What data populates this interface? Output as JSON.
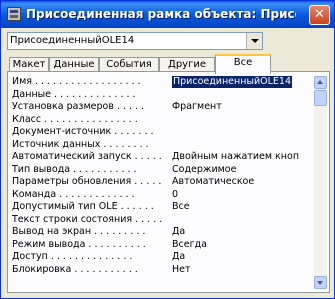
{
  "window": {
    "title": "Присоединенная рамка объекта: Присоедина...",
    "close_label": "✕"
  },
  "object_selector": {
    "value": "ПрисоединенныйOLE14"
  },
  "tabs": [
    {
      "label": "Макет"
    },
    {
      "label": "Данные"
    },
    {
      "label": "События"
    },
    {
      "label": "Другие"
    },
    {
      "label": "Все",
      "active": true
    }
  ],
  "properties": [
    {
      "name": "Имя . . . . . . . . . . . . . . . . . .",
      "value": "ПрисоединенныйOLE14"
    },
    {
      "name": "Данные . . . . . . . . . . . . . .",
      "value": ""
    },
    {
      "name": "Установка размеров . . . . .",
      "value": "Фрагмент"
    },
    {
      "name": "Класс . . . . . . . . . . . . . . . .",
      "value": ""
    },
    {
      "name": "Документ-источник . . . . . . .",
      "value": ""
    },
    {
      "name": "Источник данных . . . . . . . .",
      "value": ""
    },
    {
      "name": "Автоматический запуск . . . . .",
      "value": "Двойным нажатием кноп"
    },
    {
      "name": "Тип вывода . . . . . . . . . . .",
      "value": "Содержимое"
    },
    {
      "name": "Параметры обновления . . . . .",
      "value": "Автоматическое"
    },
    {
      "name": "Команда . . . . . . . . . . . . .",
      "value": "0"
    },
    {
      "name": "Допустимый тип OLE . . . . . .",
      "value": "Все"
    },
    {
      "name": "Текст строки состояния . . . . .",
      "value": ""
    },
    {
      "name": "Вывод на экран . . . . . . . . .",
      "value": "Да"
    },
    {
      "name": "Режим вывода . . . . . . . . . .",
      "value": "Всегда"
    },
    {
      "name": "Доступ . . . . . . . . . . . . . .",
      "value": "Да"
    },
    {
      "name": "Блокировка . . . . . . . . . . .",
      "value": "Нет"
    }
  ]
}
